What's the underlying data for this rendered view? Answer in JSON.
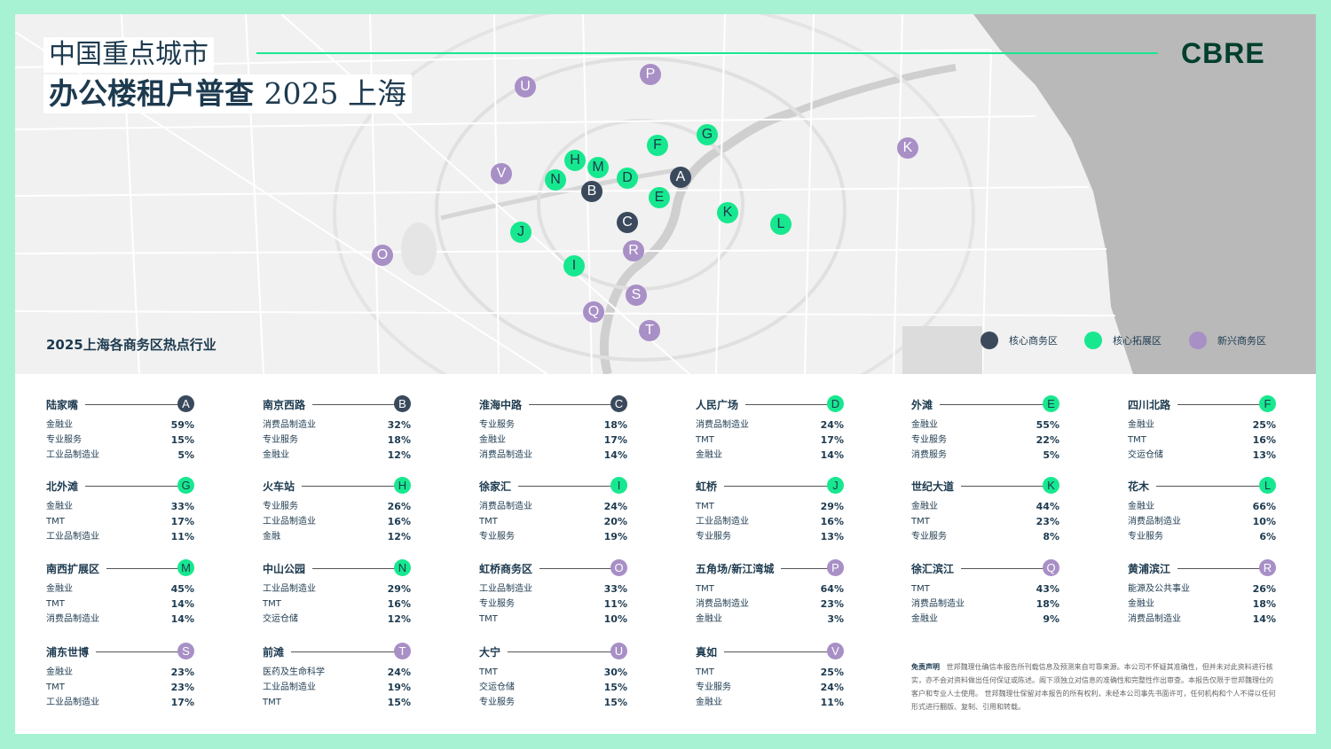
{
  "header": {
    "title_line1": "中国重点城市",
    "title_line2_bold": "办公楼租户普查",
    "title_line2_light": "2025  上海",
    "logo_text": "CBRE"
  },
  "map": {
    "subtitle": "2025上海各商务区热点行业",
    "legend": [
      {
        "label": "核心商务区",
        "category": "core"
      },
      {
        "label": "核心拓展区",
        "category": "expansion"
      },
      {
        "label": "新兴商务区",
        "category": "emerging"
      }
    ],
    "markers": [
      {
        "letter": "A",
        "category": "core"
      },
      {
        "letter": "B",
        "category": "core"
      },
      {
        "letter": "C",
        "category": "core"
      },
      {
        "letter": "D",
        "category": "expansion"
      },
      {
        "letter": "E",
        "category": "expansion"
      },
      {
        "letter": "F",
        "category": "expansion"
      },
      {
        "letter": "G",
        "category": "expansion"
      },
      {
        "letter": "H",
        "category": "expansion"
      },
      {
        "letter": "I",
        "category": "expansion"
      },
      {
        "letter": "J",
        "category": "expansion"
      },
      {
        "letter": "K",
        "category": "expansion"
      },
      {
        "letter": "K",
        "category": "emerging"
      },
      {
        "letter": "L",
        "category": "expansion"
      },
      {
        "letter": "M",
        "category": "expansion"
      },
      {
        "letter": "N",
        "category": "expansion"
      },
      {
        "letter": "O",
        "category": "emerging"
      },
      {
        "letter": "P",
        "category": "emerging"
      },
      {
        "letter": "Q",
        "category": "emerging"
      },
      {
        "letter": "R",
        "category": "emerging"
      },
      {
        "letter": "S",
        "category": "emerging"
      },
      {
        "letter": "T",
        "category": "emerging"
      },
      {
        "letter": "U",
        "category": "emerging"
      },
      {
        "letter": "V",
        "category": "emerging"
      }
    ]
  },
  "colors": {
    "core": "#3a4a5c",
    "expansion": "#17e88f",
    "emerging": "#a88fc6",
    "accent": "#17e88f",
    "brand": "#003f2d",
    "frame": "#a6f2d3"
  },
  "districts": [
    {
      "name": "陆家嘴",
      "letter": "A",
      "category": "core",
      "rows": [
        [
          "金融业",
          "59%"
        ],
        [
          "专业服务",
          "15%"
        ],
        [
          "工业品制造业",
          "5%"
        ]
      ]
    },
    {
      "name": "南京西路",
      "letter": "B",
      "category": "core",
      "rows": [
        [
          "消费品制造业",
          "32%"
        ],
        [
          "专业服务",
          "18%"
        ],
        [
          "金融业",
          "12%"
        ]
      ]
    },
    {
      "name": "淮海中路",
      "letter": "C",
      "category": "core",
      "rows": [
        [
          "专业服务",
          "18%"
        ],
        [
          "金融业",
          "17%"
        ],
        [
          "消费品制造业",
          "14%"
        ]
      ]
    },
    {
      "name": "人民广场",
      "letter": "D",
      "category": "expansion",
      "rows": [
        [
          "消费品制造业",
          "24%"
        ],
        [
          "TMT",
          "17%"
        ],
        [
          "金融业",
          "14%"
        ]
      ]
    },
    {
      "name": "外滩",
      "letter": "E",
      "category": "expansion",
      "rows": [
        [
          "金融业",
          "55%"
        ],
        [
          "专业服务",
          "22%"
        ],
        [
          "消费服务",
          "5%"
        ]
      ]
    },
    {
      "name": "四川北路",
      "letter": "F",
      "category": "expansion",
      "rows": [
        [
          "金融业",
          "25%"
        ],
        [
          "TMT",
          "16%"
        ],
        [
          "交运仓储",
          "13%"
        ]
      ]
    },
    {
      "name": "北外滩",
      "letter": "G",
      "category": "expansion",
      "rows": [
        [
          "金融业",
          "33%"
        ],
        [
          "TMT",
          "17%"
        ],
        [
          "工业品制造业",
          "11%"
        ]
      ]
    },
    {
      "name": "火车站",
      "letter": "H",
      "category": "expansion",
      "rows": [
        [
          "专业服务",
          "26%"
        ],
        [
          "工业品制造业",
          "16%"
        ],
        [
          "金融",
          "12%"
        ]
      ]
    },
    {
      "name": "徐家汇",
      "letter": "I",
      "category": "expansion",
      "rows": [
        [
          "消费品制造业",
          "24%"
        ],
        [
          "TMT",
          "20%"
        ],
        [
          "专业服务",
          "19%"
        ]
      ]
    },
    {
      "name": "虹桥",
      "letter": "J",
      "category": "expansion",
      "rows": [
        [
          "TMT",
          "29%"
        ],
        [
          "工业品制造业",
          "16%"
        ],
        [
          "专业服务",
          "13%"
        ]
      ]
    },
    {
      "name": "世纪大道",
      "letter": "K",
      "category": "expansion",
      "rows": [
        [
          "金融业",
          "44%"
        ],
        [
          "TMT",
          "23%"
        ],
        [
          "专业服务",
          "8%"
        ]
      ]
    },
    {
      "name": "花木",
      "letter": "L",
      "category": "expansion",
      "rows": [
        [
          "金融业",
          "66%"
        ],
        [
          "消费品制造业",
          "10%"
        ],
        [
          "专业服务",
          "6%"
        ]
      ]
    },
    {
      "name": "南西扩展区",
      "letter": "M",
      "category": "expansion",
      "rows": [
        [
          "金融业",
          "45%"
        ],
        [
          "TMT",
          "14%"
        ],
        [
          "消费品制造业",
          "14%"
        ]
      ]
    },
    {
      "name": "中山公园",
      "letter": "N",
      "category": "expansion",
      "rows": [
        [
          "工业品制造业",
          "29%"
        ],
        [
          "TMT",
          "16%"
        ],
        [
          "交运仓储",
          "12%"
        ]
      ]
    },
    {
      "name": "虹桥商务区",
      "letter": "O",
      "category": "emerging",
      "rows": [
        [
          "工业品制造业",
          "33%"
        ],
        [
          "专业服务",
          "11%"
        ],
        [
          "TMT",
          "10%"
        ]
      ]
    },
    {
      "name": "五角场/新江湾城",
      "letter": "P",
      "category": "emerging",
      "rows": [
        [
          "TMT",
          "64%"
        ],
        [
          "消费品制造业",
          "23%"
        ],
        [
          "金融业",
          "3%"
        ]
      ]
    },
    {
      "name": "徐汇滨江",
      "letter": "Q",
      "category": "emerging",
      "rows": [
        [
          "TMT",
          "43%"
        ],
        [
          "消费品制造业",
          "18%"
        ],
        [
          "金融业",
          "9%"
        ]
      ]
    },
    {
      "name": "黄浦滨江",
      "letter": "R",
      "category": "emerging",
      "rows": [
        [
          "能源及公共事业",
          "26%"
        ],
        [
          "金融业",
          "18%"
        ],
        [
          "消费品制造业",
          "14%"
        ]
      ]
    },
    {
      "name": "浦东世博",
      "letter": "S",
      "category": "emerging",
      "rows": [
        [
          "金融业",
          "23%"
        ],
        [
          "TMT",
          "23%"
        ],
        [
          "工业品制造业",
          "17%"
        ]
      ]
    },
    {
      "name": "前滩",
      "letter": "T",
      "category": "emerging",
      "rows": [
        [
          "医药及生命科学",
          "24%"
        ],
        [
          "工业品制造业",
          "19%"
        ],
        [
          "TMT",
          "15%"
        ]
      ]
    },
    {
      "name": "大宁",
      "letter": "U",
      "category": "emerging",
      "rows": [
        [
          "TMT",
          "30%"
        ],
        [
          "交运仓储",
          "15%"
        ],
        [
          "专业服务",
          "15%"
        ]
      ]
    },
    {
      "name": "真如",
      "letter": "V",
      "category": "emerging",
      "rows": [
        [
          "TMT",
          "25%"
        ],
        [
          "专业服务",
          "24%"
        ],
        [
          "金融业",
          "11%"
        ]
      ]
    }
  ],
  "disclaimer": {
    "label": "免责声明",
    "text": "世邦魏理仕确信本报告所刊载信息及预测来自可靠来源。本公司不怀疑其准确性，但并未对此资料进行核实，亦不会对资料做出任何保证或陈述。阁下须独立对信息的准确性和完整性作出审查。本报告仅限于世邦魏理仕的客户和专业人士使用。 世邦魏理仕保留对本报告的所有权利，未经本公司事先书面许可，任何机构和个人不得以任何形式进行翻版、复制、引用和转载。"
  }
}
